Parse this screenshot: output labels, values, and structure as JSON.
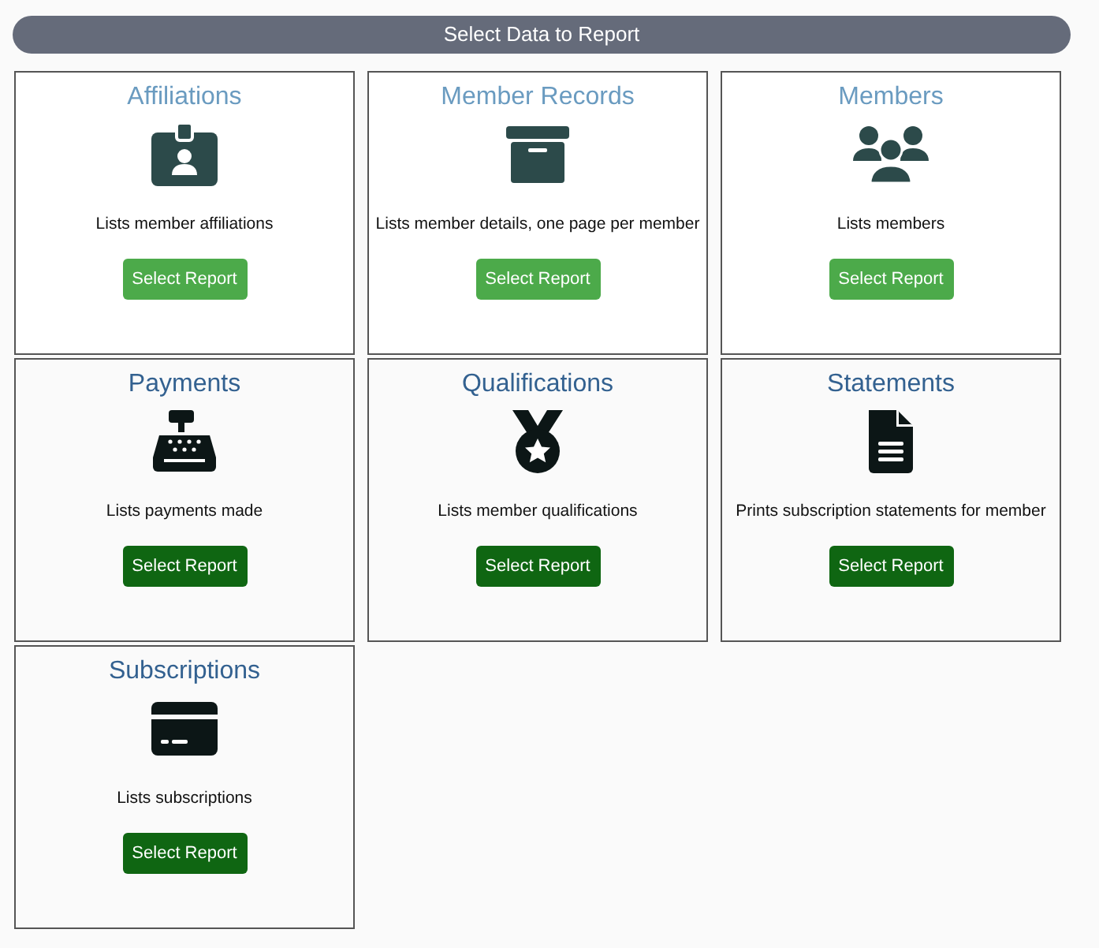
{
  "header": {
    "title": "Select Data to Report"
  },
  "reports": [
    {
      "title": "Affiliations",
      "kind": "badge",
      "description": "Lists member affiliations",
      "button": "Select Report",
      "highlighted": true
    },
    {
      "title": "Member Records",
      "kind": "archive",
      "description": "Lists member details, one page per member",
      "button": "Select Report",
      "highlighted": true
    },
    {
      "title": "Members",
      "kind": "users",
      "description": "Lists members",
      "button": "Select Report",
      "highlighted": true
    },
    {
      "title": "Payments",
      "kind": "register",
      "description": "Lists payments made",
      "button": "Select Report",
      "highlighted": false
    },
    {
      "title": "Qualifications",
      "kind": "medal",
      "description": "Lists member qualifications",
      "button": "Select Report",
      "highlighted": false
    },
    {
      "title": "Statements",
      "kind": "file",
      "description": "Prints subscription statements for member",
      "button": "Select Report",
      "highlighted": false
    },
    {
      "title": "Subscriptions",
      "kind": "card",
      "description": "Lists subscriptions",
      "button": "Select Report",
      "highlighted": false
    }
  ]
}
